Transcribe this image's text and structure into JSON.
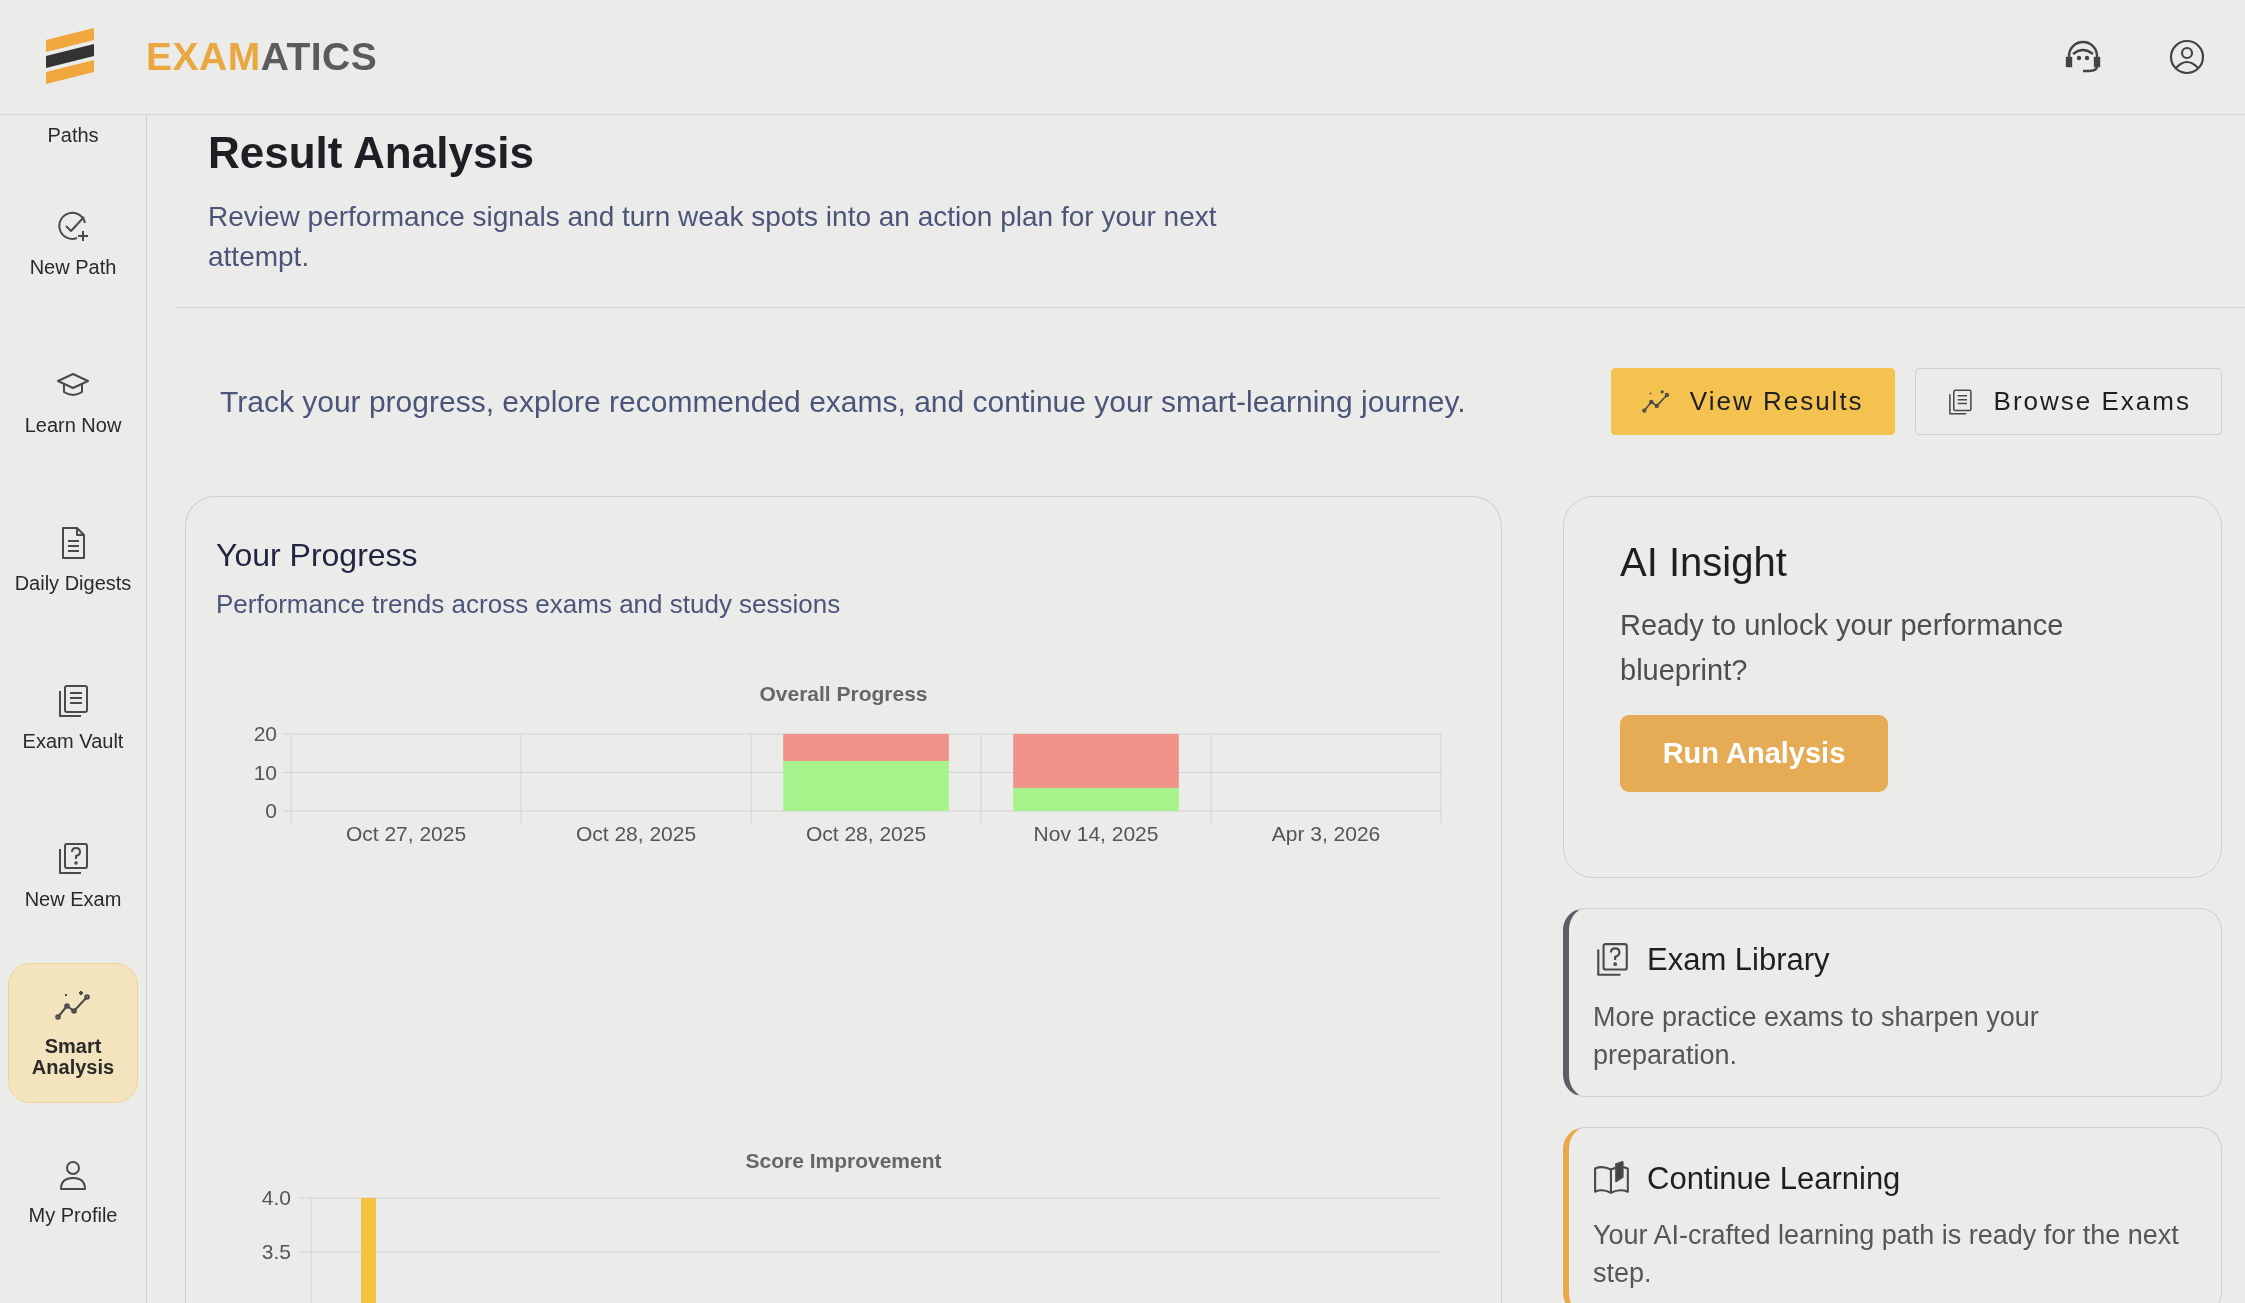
{
  "brand": {
    "part_1": "EXAM",
    "part_2": "ATICS"
  },
  "sidebar": {
    "items": [
      {
        "label": "Paths",
        "selected": false
      },
      {
        "label": "New Path",
        "selected": false
      },
      {
        "label": "Learn Now",
        "selected": false
      },
      {
        "label": "Daily Digests",
        "selected": false
      },
      {
        "label": "Exam Vault",
        "selected": false
      },
      {
        "label": "New Exam",
        "selected": false
      },
      {
        "label": "Smart Analysis",
        "selected": true
      },
      {
        "label": "My Profile",
        "selected": false
      }
    ]
  },
  "page": {
    "title": "Result Analysis",
    "subtitle": "Review performance signals and turn weak spots into an action plan for your next attempt."
  },
  "toolbar": {
    "text": "Track your progress, explore recommended exams, and continue your smart-learning journey.",
    "buttons": [
      {
        "label": "View Results",
        "kind": "primary"
      },
      {
        "label": "Browse Exams",
        "kind": "outline"
      }
    ]
  },
  "progress_card": {
    "title": "Your Progress",
    "subtitle": "Performance trends across exams and study sessions",
    "charts": [
      {
        "chart_data": {
          "type": "bar",
          "title": "Overall Progress",
          "categories": [
            "Oct 27, 2025",
            "Oct 28, 2025",
            "Oct 28, 2025",
            "Nov 14, 2025",
            "Apr 3, 2026"
          ],
          "stacked": true,
          "ylim": [
            0,
            20
          ],
          "yticks": [
            20,
            10,
            0
          ],
          "series": [
            {
              "color": "#a6f38c",
              "values": [
                0,
                0,
                13,
                6,
                0
              ]
            },
            {
              "color": "#ee928a",
              "values": [
                0,
                0,
                7,
                14,
                0
              ]
            }
          ]
        }
      },
      {
        "chart_data": {
          "type": "bar",
          "title": "Score Improvement",
          "ylim": [
            3,
            4
          ],
          "yticks": [
            {
              "value": 4,
              "label": "4.0"
            },
            {
              "value": 3.5,
              "label": "3.5"
            }
          ],
          "series": [
            {
              "color": "#f6c23e",
              "values": [
                4
              ]
            }
          ]
        }
      }
    ]
  },
  "insight_card": {
    "title": "AI Insight",
    "text": "Ready to unlock your performance blueprint?",
    "button": "Run Analysis"
  },
  "feature_cards": [
    {
      "title": "Exam Library",
      "text": "More practice exams to sharpen your preparation.",
      "color": "#5d5d66"
    },
    {
      "title": "Continue Learning",
      "text": "Your AI-crafted learning path is ready for the next step.",
      "color": "#e8a84a"
    }
  ]
}
